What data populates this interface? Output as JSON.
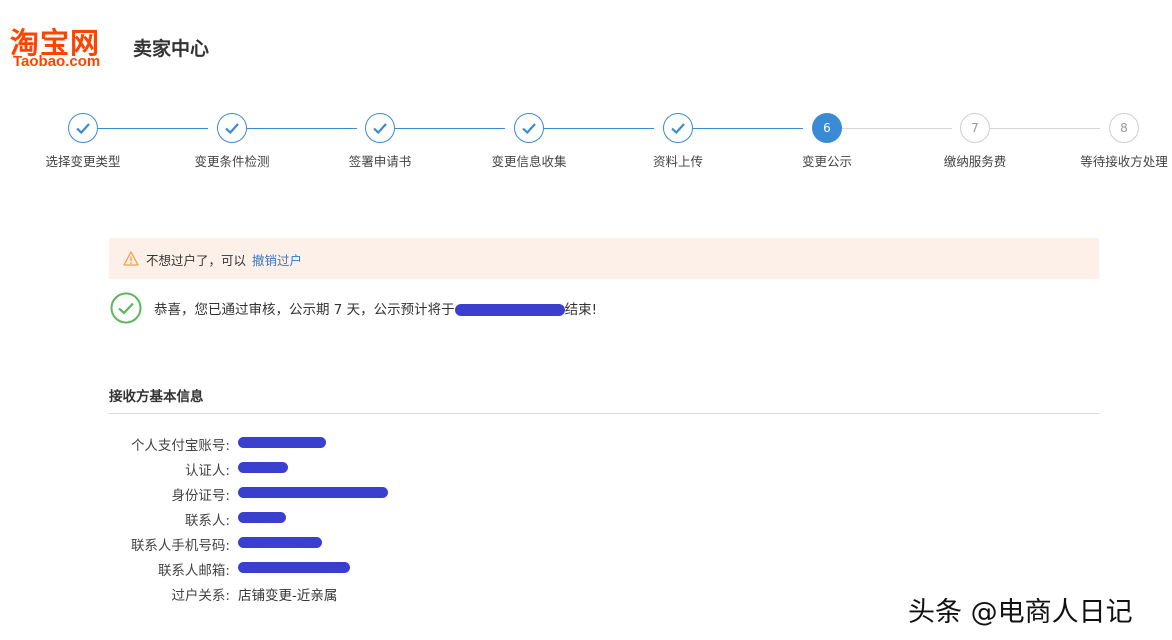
{
  "header": {
    "logo_cn": "淘宝网",
    "logo_en": "Taobao.com",
    "center_title": "卖家中心"
  },
  "steps": [
    {
      "label": "选择变更类型",
      "status": "done",
      "num": "1"
    },
    {
      "label": "变更条件检测",
      "status": "done",
      "num": "2"
    },
    {
      "label": "签署申请书",
      "status": "done",
      "num": "3"
    },
    {
      "label": "变更信息收集",
      "status": "done",
      "num": "4"
    },
    {
      "label": "资料上传",
      "status": "done",
      "num": "5"
    },
    {
      "label": "变更公示",
      "status": "active",
      "num": "6"
    },
    {
      "label": "缴纳服务费",
      "status": "todo",
      "num": "7"
    },
    {
      "label": "等待接收方处理",
      "status": "todo",
      "num": "8"
    }
  ],
  "notice": {
    "text": "不想过户了，可以",
    "link": "撤销过户"
  },
  "success": {
    "prefix": "恭喜，您已通过审核，公示期 7 天，公示预计将于",
    "suffix": "结束!"
  },
  "section": {
    "title": "接收方基本信息"
  },
  "info": [
    {
      "label": "个人支付宝账号:",
      "value": ""
    },
    {
      "label": "认证人:",
      "value": ""
    },
    {
      "label": "身份证号:",
      "value": ""
    },
    {
      "label": "联系人:",
      "value": ""
    },
    {
      "label": "联系人手机号码:",
      "value": ""
    },
    {
      "label": "联系人邮箱:",
      "value": ""
    },
    {
      "label": "过户关系:",
      "value": "店铺变更-近亲属"
    }
  ],
  "watermark": "头条 @电商人日记",
  "colors": {
    "brand": "#ff4400",
    "accent": "#3a8ad4",
    "success": "#5cb85c",
    "warning": "#f0a050",
    "notice_bg": "#fdf0e8"
  }
}
